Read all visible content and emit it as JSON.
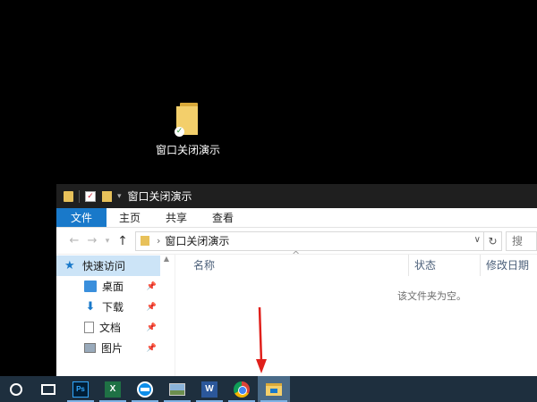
{
  "desktop": {
    "folder_label": "窗口关闭演示"
  },
  "window": {
    "title": "窗口关闭演示",
    "ribbon_tabs": [
      "文件",
      "主页",
      "共享",
      "查看"
    ],
    "address": {
      "path": "窗口关闭演示",
      "search_placeholder": "搜"
    },
    "nav_pane": {
      "quick_access": "快速访问",
      "items": [
        "桌面",
        "下载",
        "文档",
        "图片"
      ]
    },
    "columns": [
      "名称",
      "状态",
      "修改日期"
    ],
    "empty_message": "该文件夹为空。"
  },
  "taskbar": {
    "apps": [
      "cortana",
      "task-view",
      "photoshop",
      "excel",
      "teamviewer",
      "image-viewer",
      "word",
      "chrome",
      "file-explorer"
    ],
    "ps_label": "Ps",
    "xl_label": "X",
    "wd_label": "W"
  },
  "colors": {
    "accent": "#1979ca",
    "annotation": "#e0201b",
    "taskbar": "#1e2f3e"
  }
}
